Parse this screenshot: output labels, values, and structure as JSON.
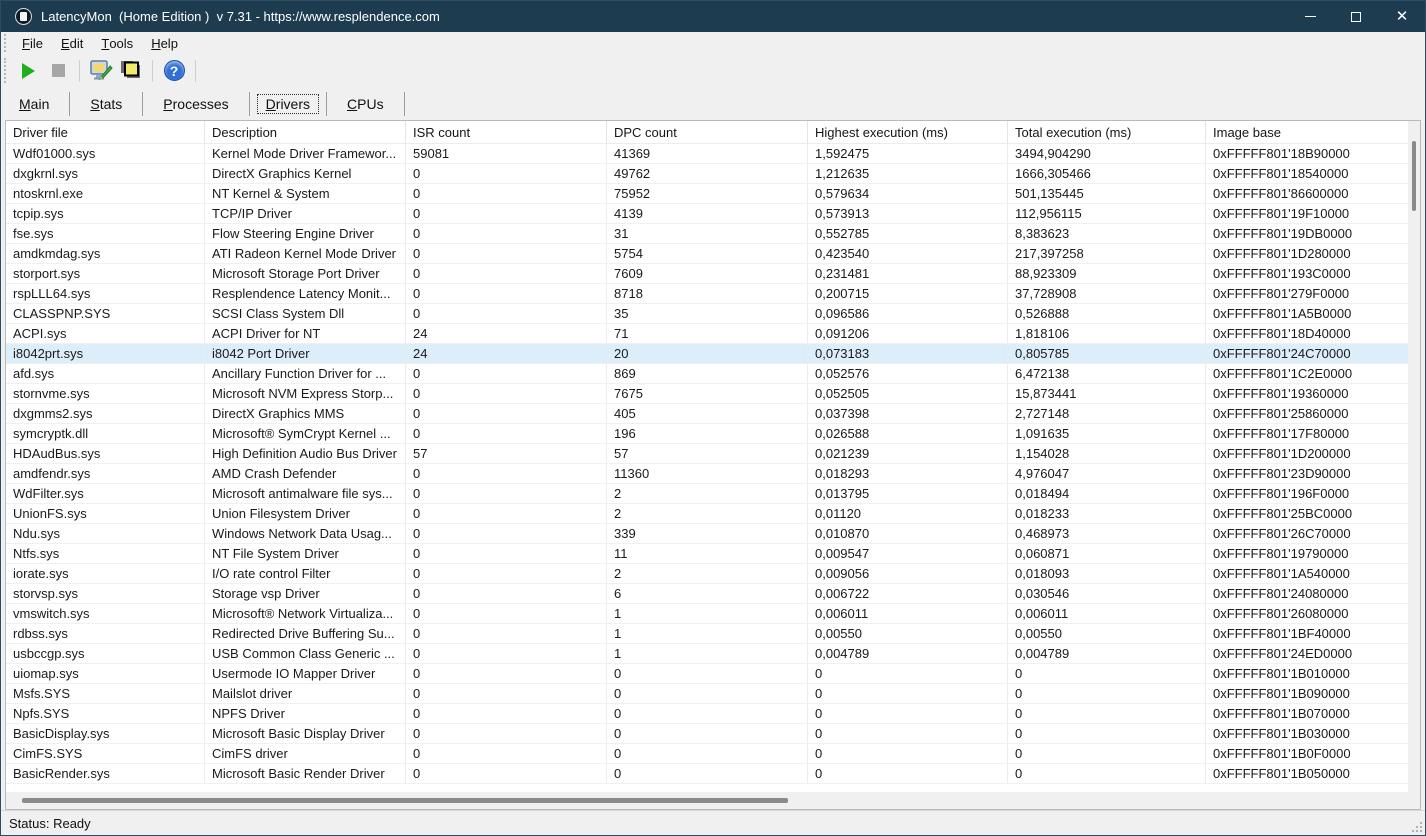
{
  "window": {
    "title": "LatencyMon  (Home Edition )  v 7.31 - https://www.resplendence.com",
    "status": "Status: Ready"
  },
  "colors": {
    "titlebar_bg": "#1e3c50",
    "titlebar_text": "#ffffff",
    "chrome_bg": "#f0f0f0",
    "selected_row_bg": "#dceef9",
    "play_green": "#1fae1f",
    "help_blue": "#2f6fd6"
  },
  "menu": {
    "items": [
      "File",
      "Edit",
      "Tools",
      "Help"
    ]
  },
  "toolbar": {
    "buttons": [
      {
        "name": "start-monitor-button",
        "icon": "play-icon"
      },
      {
        "name": "stop-monitor-button",
        "icon": "stop-icon"
      },
      {
        "name": "options-button",
        "icon": "monitor-tool-icon"
      },
      {
        "name": "report-button",
        "icon": "copy-pages-icon"
      },
      {
        "name": "help-button",
        "icon": "question-icon",
        "glyph": "?"
      }
    ]
  },
  "tabs": {
    "items": [
      "Main",
      "Stats",
      "Processes",
      "Drivers",
      "CPUs"
    ],
    "selected_index": 3
  },
  "table": {
    "columns": [
      "Driver file",
      "Description",
      "ISR count",
      "DPC count",
      "Highest execution (ms)",
      "Total execution (ms)",
      "Image base"
    ],
    "selected_index": 10,
    "rows": [
      [
        "Wdf01000.sys",
        "Kernel Mode Driver Framewor...",
        "59081",
        "41369",
        "1,592475",
        "3494,904290",
        "0xFFFFF801'18B90000"
      ],
      [
        "dxgkrnl.sys",
        "DirectX Graphics Kernel",
        "0",
        "49762",
        "1,212635",
        "1666,305466",
        "0xFFFFF801'18540000"
      ],
      [
        "ntoskrnl.exe",
        "NT Kernel & System",
        "0",
        "75952",
        "0,579634",
        "501,135445",
        "0xFFFFF801'86600000"
      ],
      [
        "tcpip.sys",
        "TCP/IP Driver",
        "0",
        "4139",
        "0,573913",
        "112,956115",
        "0xFFFFF801'19F10000"
      ],
      [
        "fse.sys",
        "Flow Steering Engine Driver",
        "0",
        "31",
        "0,552785",
        "8,383623",
        "0xFFFFF801'19DB0000"
      ],
      [
        "amdkmdag.sys",
        "ATI Radeon Kernel Mode Driver",
        "0",
        "5754",
        "0,423540",
        "217,397258",
        "0xFFFFF801'1D280000"
      ],
      [
        "storport.sys",
        "Microsoft Storage Port Driver",
        "0",
        "7609",
        "0,231481",
        "88,923309",
        "0xFFFFF801'193C0000"
      ],
      [
        "rspLLL64.sys",
        "Resplendence Latency Monit...",
        "0",
        "8718",
        "0,200715",
        "37,728908",
        "0xFFFFF801'279F0000"
      ],
      [
        "CLASSPNP.SYS",
        "SCSI Class System Dll",
        "0",
        "35",
        "0,096586",
        "0,526888",
        "0xFFFFF801'1A5B0000"
      ],
      [
        "ACPI.sys",
        "ACPI Driver for NT",
        "24",
        "71",
        "0,091206",
        "1,818106",
        "0xFFFFF801'18D40000"
      ],
      [
        "i8042prt.sys",
        "i8042 Port Driver",
        "24",
        "20",
        "0,073183",
        "0,805785",
        "0xFFFFF801'24C70000"
      ],
      [
        "afd.sys",
        "Ancillary Function Driver for ...",
        "0",
        "869",
        "0,052576",
        "6,472138",
        "0xFFFFF801'1C2E0000"
      ],
      [
        "stornvme.sys",
        "Microsoft NVM Express Storp...",
        "0",
        "7675",
        "0,052505",
        "15,873441",
        "0xFFFFF801'19360000"
      ],
      [
        "dxgmms2.sys",
        "DirectX Graphics MMS",
        "0",
        "405",
        "0,037398",
        "2,727148",
        "0xFFFFF801'25860000"
      ],
      [
        "symcryptk.dll",
        "Microsoft® SymCrypt Kernel ...",
        "0",
        "196",
        "0,026588",
        "1,091635",
        "0xFFFFF801'17F80000"
      ],
      [
        "HDAudBus.sys",
        "High Definition Audio Bus Driver",
        "57",
        "57",
        "0,021239",
        "1,154028",
        "0xFFFFF801'1D200000"
      ],
      [
        "amdfendr.sys",
        "AMD Crash Defender",
        "0",
        "11360",
        "0,018293",
        "4,976047",
        "0xFFFFF801'23D90000"
      ],
      [
        "WdFilter.sys",
        "Microsoft antimalware file sys...",
        "0",
        "2",
        "0,013795",
        "0,018494",
        "0xFFFFF801'196F0000"
      ],
      [
        "UnionFS.sys",
        "Union Filesystem Driver",
        "0",
        "2",
        "0,01120",
        "0,018233",
        "0xFFFFF801'25BC0000"
      ],
      [
        "Ndu.sys",
        "Windows Network Data Usag...",
        "0",
        "339",
        "0,010870",
        "0,468973",
        "0xFFFFF801'26C70000"
      ],
      [
        "Ntfs.sys",
        "NT File System Driver",
        "0",
        "11",
        "0,009547",
        "0,060871",
        "0xFFFFF801'19790000"
      ],
      [
        "iorate.sys",
        "I/O rate control Filter",
        "0",
        "2",
        "0,009056",
        "0,018093",
        "0xFFFFF801'1A540000"
      ],
      [
        "storvsp.sys",
        "Storage vsp Driver",
        "0",
        "6",
        "0,006722",
        "0,030546",
        "0xFFFFF801'24080000"
      ],
      [
        "vmswitch.sys",
        "Microsoft® Network Virtualiza...",
        "0",
        "1",
        "0,006011",
        "0,006011",
        "0xFFFFF801'26080000"
      ],
      [
        "rdbss.sys",
        "Redirected Drive Buffering Su...",
        "0",
        "1",
        "0,00550",
        "0,00550",
        "0xFFFFF801'1BF40000"
      ],
      [
        "usbccgp.sys",
        "USB Common Class Generic ...",
        "0",
        "1",
        "0,004789",
        "0,004789",
        "0xFFFFF801'24ED0000"
      ],
      [
        "uiomap.sys",
        "Usermode IO Mapper Driver",
        "0",
        "0",
        "0",
        "0",
        "0xFFFFF801'1B010000"
      ],
      [
        "Msfs.SYS",
        "Mailslot driver",
        "0",
        "0",
        "0",
        "0",
        "0xFFFFF801'1B090000"
      ],
      [
        "Npfs.SYS",
        "NPFS Driver",
        "0",
        "0",
        "0",
        "0",
        "0xFFFFF801'1B070000"
      ],
      [
        "BasicDisplay.sys",
        "Microsoft Basic Display Driver",
        "0",
        "0",
        "0",
        "0",
        "0xFFFFF801'1B030000"
      ],
      [
        "CimFS.SYS",
        "CimFS driver",
        "0",
        "0",
        "0",
        "0",
        "0xFFFFF801'1B0F0000"
      ],
      [
        "BasicRender.sys",
        "Microsoft Basic Render Driver",
        "0",
        "0",
        "0",
        "0",
        "0xFFFFF801'1B050000"
      ]
    ]
  }
}
